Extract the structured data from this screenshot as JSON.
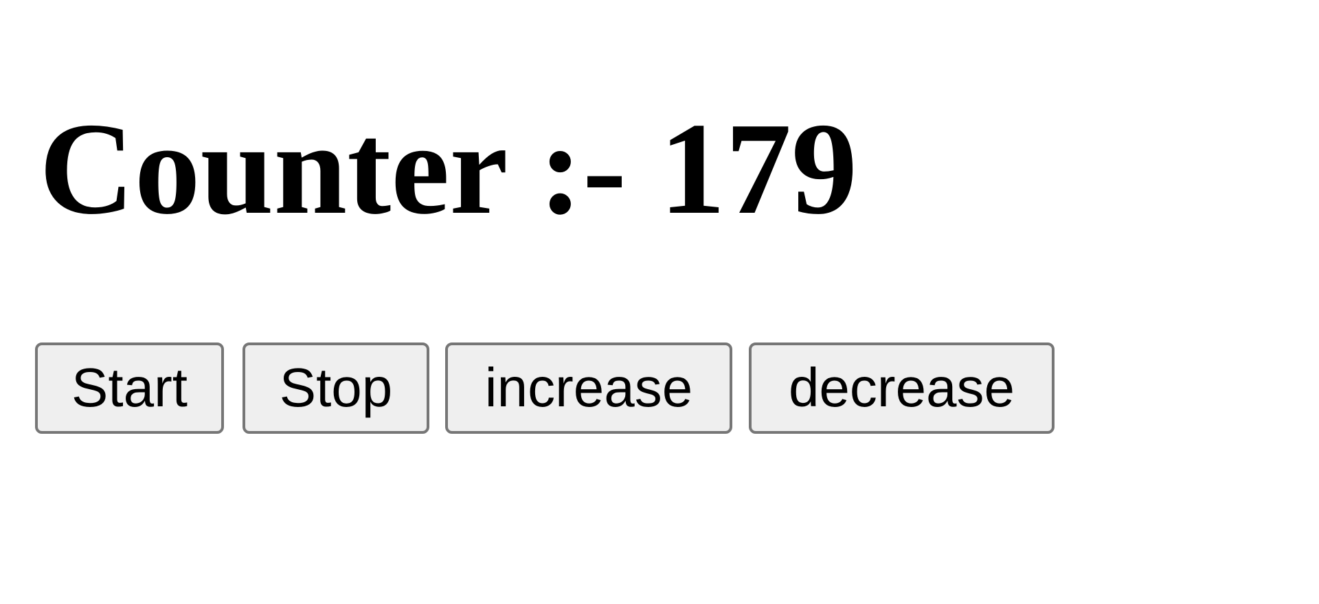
{
  "counter": {
    "label": "Counter :-",
    "value": "179"
  },
  "buttons": {
    "start": "Start",
    "stop": "Stop",
    "increase": "increase",
    "decrease": "decrease"
  },
  "colors": {
    "button_background": "#efefef",
    "button_border": "#767676",
    "text": "#000000"
  }
}
